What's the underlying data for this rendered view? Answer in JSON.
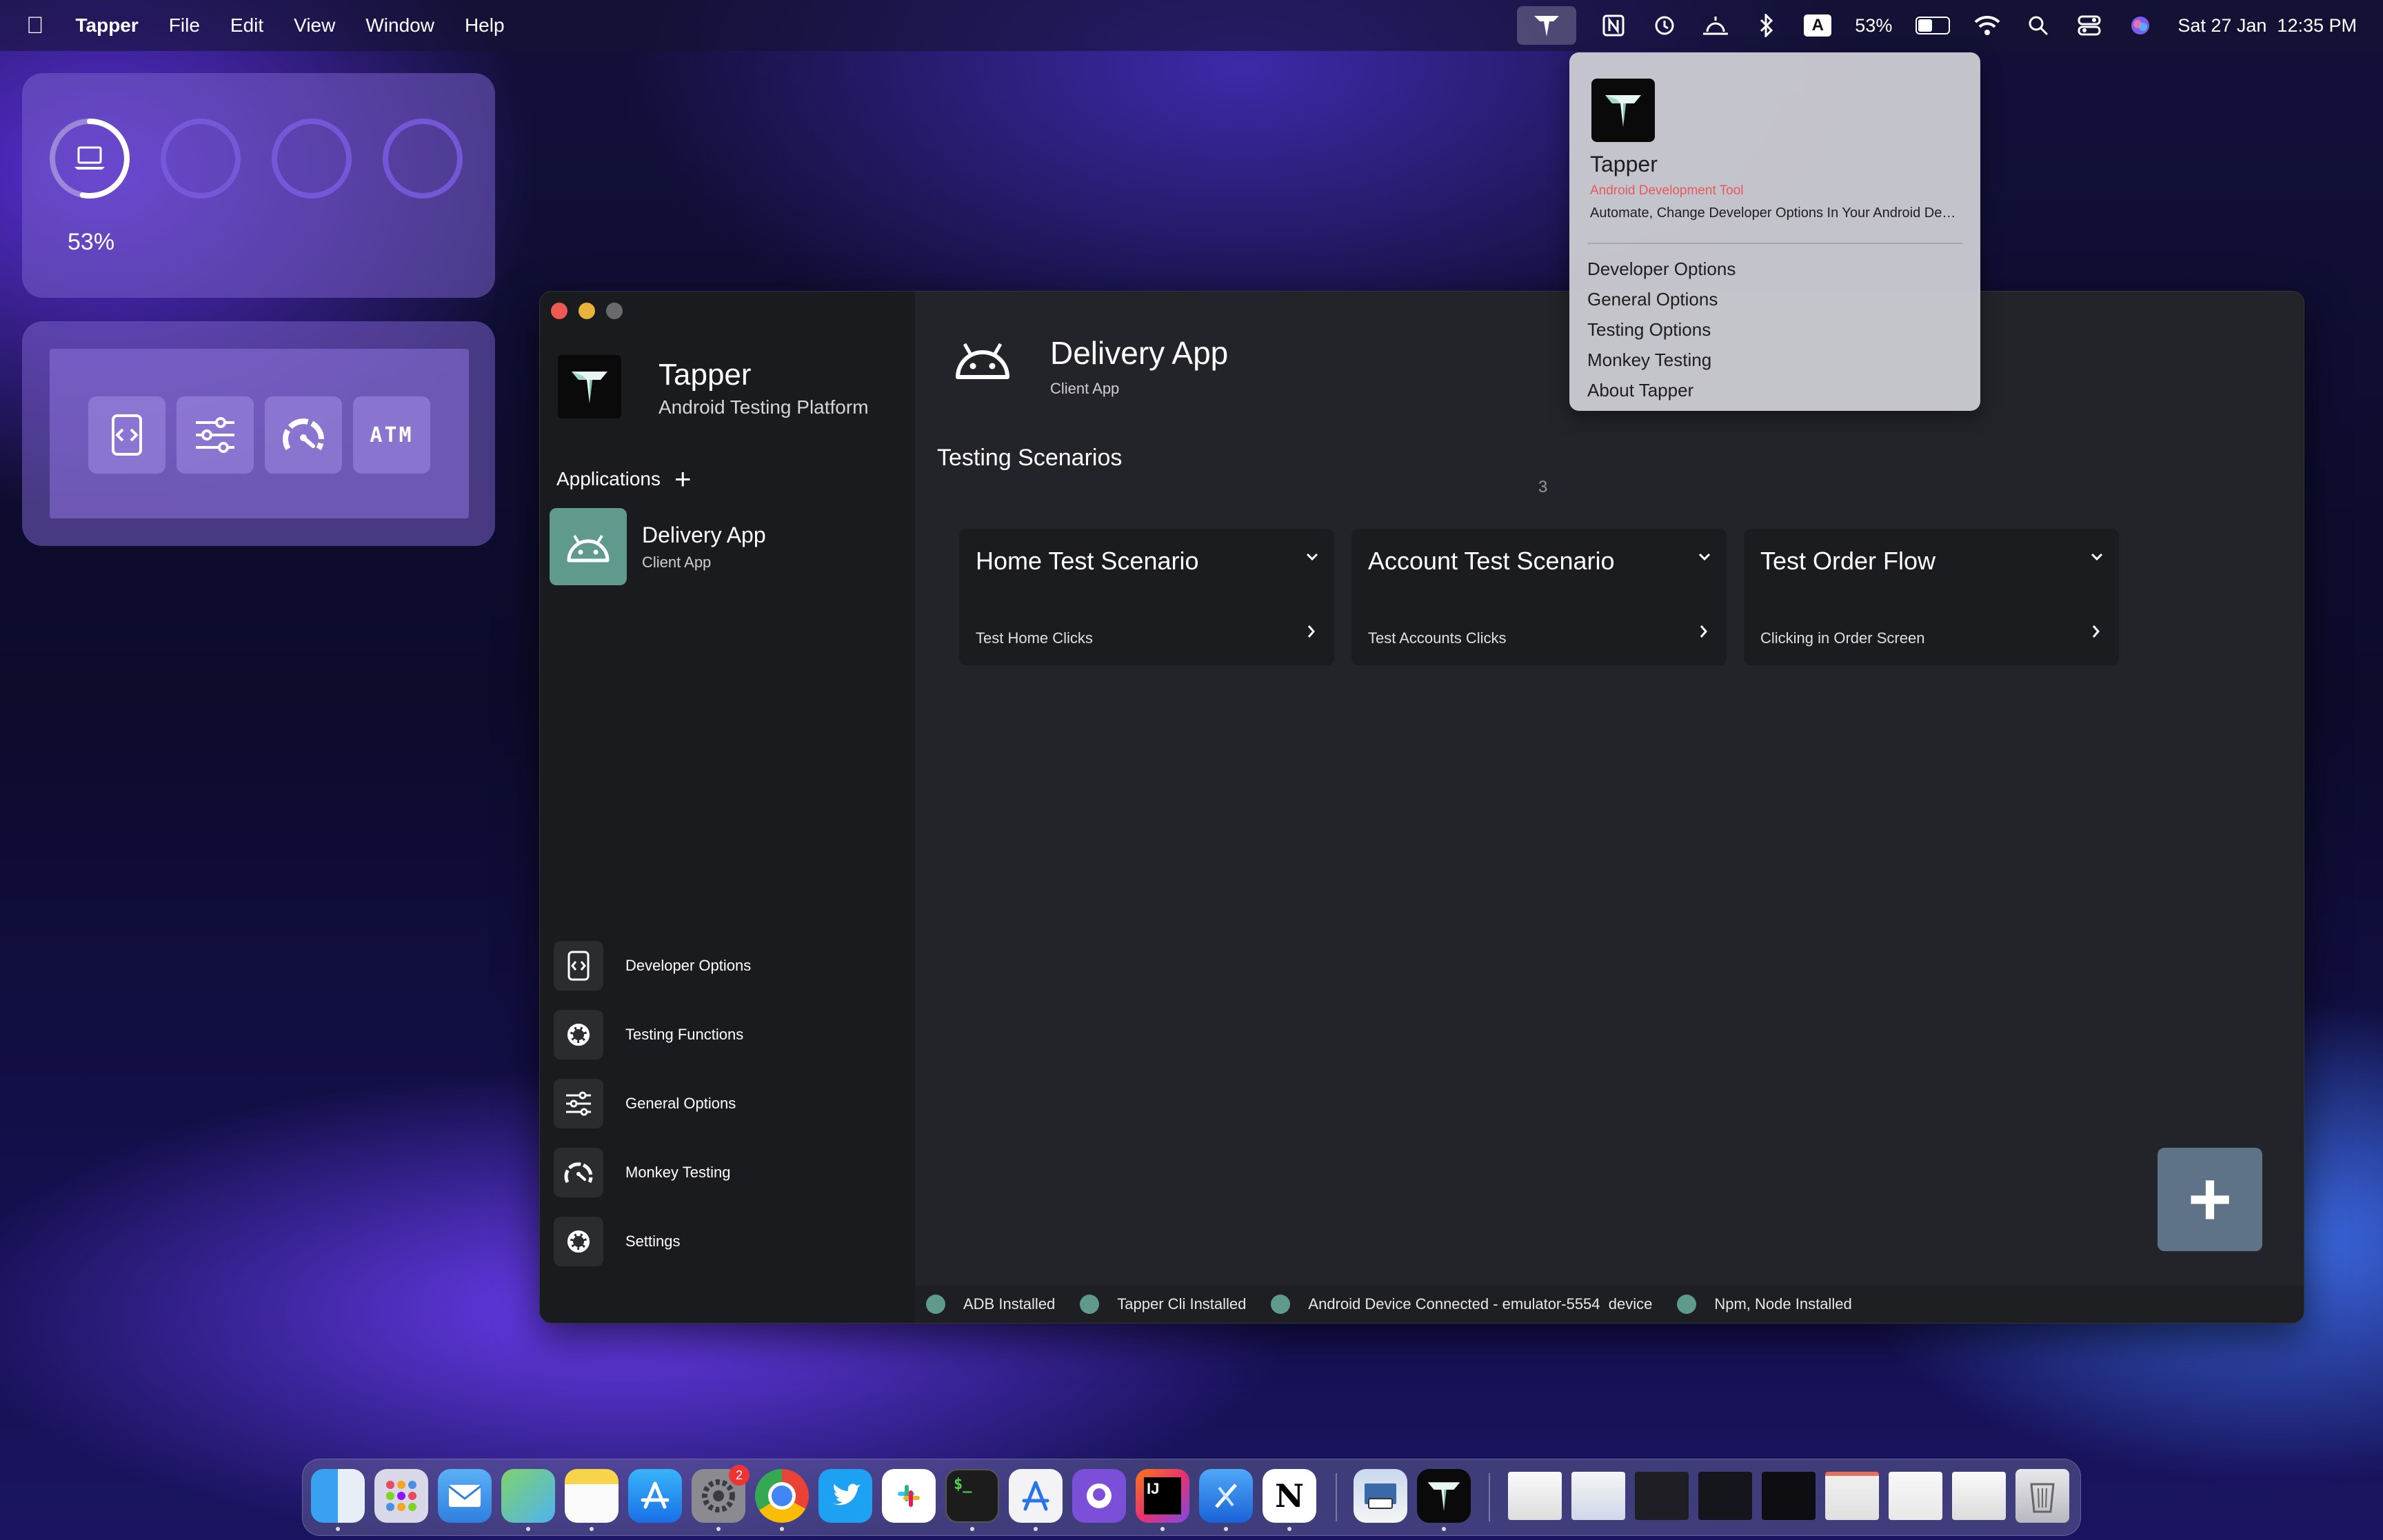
{
  "menubar": {
    "app": "Tapper",
    "items": [
      "File",
      "Edit",
      "View",
      "Window",
      "Help"
    ],
    "battery_pct": "53%",
    "battery_level": 0.53,
    "datetime": "Sat 27 Jan  12:35 PM",
    "keyboard_letter": "A",
    "status_icons": [
      "tapper-icon",
      "notion-icon",
      "time-machine-icon",
      "sun-icon",
      "bluetooth-icon",
      "keyboard-input-icon",
      "battery-icon",
      "wifi-icon",
      "search-icon",
      "control-center-icon",
      "siri-icon"
    ]
  },
  "widgets": {
    "battery": {
      "percent": "53%",
      "level": 0.53,
      "icon": "laptop-icon"
    },
    "shortcuts": [
      "developer-options-icon",
      "sliders-icon",
      "gauge-icon",
      "atm-icon"
    ],
    "atm_label": "ATM"
  },
  "sidebar": {
    "app_name": "Tapper",
    "app_subtitle": "Android Testing Platform",
    "applications_label": "Applications",
    "add_symbol": "+",
    "apps": [
      {
        "name": "Delivery App",
        "subtitle": "Client App",
        "icon": "android-icon"
      }
    ],
    "nav": [
      {
        "label": "Developer Options",
        "icon": "developer-options-icon"
      },
      {
        "label": "Testing Functions",
        "icon": "gear-icon"
      },
      {
        "label": "General Options",
        "icon": "sliders-icon"
      },
      {
        "label": "Monkey Testing",
        "icon": "gauge-icon"
      },
      {
        "label": "Settings",
        "icon": "gear-icon"
      }
    ]
  },
  "main": {
    "title": "Delivery App",
    "subtitle": "Client App",
    "section_title": "Testing Scenarios",
    "count": "3",
    "scenarios": [
      {
        "title": "Home Test Scenario",
        "subtitle": "Test Home Clicks"
      },
      {
        "title": "Account Test Scenario",
        "subtitle": "Test Accounts Clicks"
      },
      {
        "title": "Test Order Flow",
        "subtitle": "Clicking in Order Screen"
      }
    ],
    "fab_label": "+"
  },
  "status": [
    "ADB Installed",
    "Tapper Cli Installed",
    "Android Device Connected - emulator-5554  device",
    "Npm, Node Installed"
  ],
  "dropdown": {
    "name": "Tapper",
    "tag": "Android Development Tool",
    "description": "Automate, Change Developer Options In Your Android Devices",
    "items": [
      "Developer Options",
      "General Options",
      "Testing Options",
      "Monkey Testing",
      "About Tapper"
    ]
  },
  "dock": {
    "apps": [
      "finder",
      "launchpad",
      "mail",
      "maps",
      "notes",
      "app-store",
      "system-settings",
      "chrome",
      "twitter",
      "slack",
      "terminal",
      "instruments",
      "github-desktop",
      "intellij",
      "xcode",
      "notion",
      "preview",
      "tapper"
    ],
    "settings_badge": "2",
    "terminal_label": "$_",
    "intellij_label": "IJ",
    "notion_label": "N",
    "recent_windows": 8
  },
  "colors": {
    "accent_green": "#5f9a8c",
    "fab": "#5e7288",
    "sidebar_bg": "#1a1b1e",
    "main_bg": "#232429",
    "tag_red": "#e85a5a"
  }
}
